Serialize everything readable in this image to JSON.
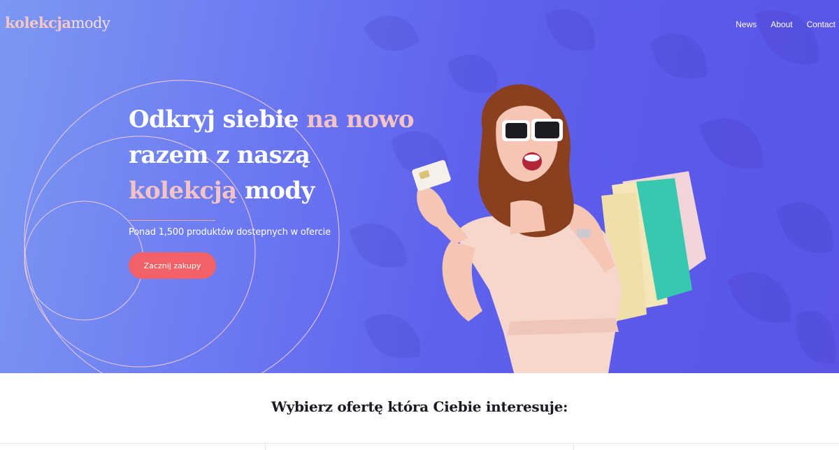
{
  "brand": {
    "logo_part1": "kolekcja",
    "logo_part2": "mody"
  },
  "nav": {
    "items": [
      "News",
      "About",
      "Contact"
    ]
  },
  "hero": {
    "headline_line1_a": "Odkryj siebie ",
    "headline_line1_b": "na nowo",
    "headline_line2": "razem z naszą",
    "headline_line3_a": "kolekcją",
    "headline_line3_b": " mody",
    "subtitle": "Ponad 1,500 produktów dostepnych w ofercie",
    "cta_label": "Zacznij zakupy"
  },
  "offers": {
    "title": "Wybierz ofertę która Ciebie interesuje:"
  },
  "colors": {
    "accent_pink": "#f6c3c5",
    "cta": "#f16167",
    "hero_gradient_start": "#7b98f3",
    "hero_gradient_end": "#5a55e6"
  }
}
